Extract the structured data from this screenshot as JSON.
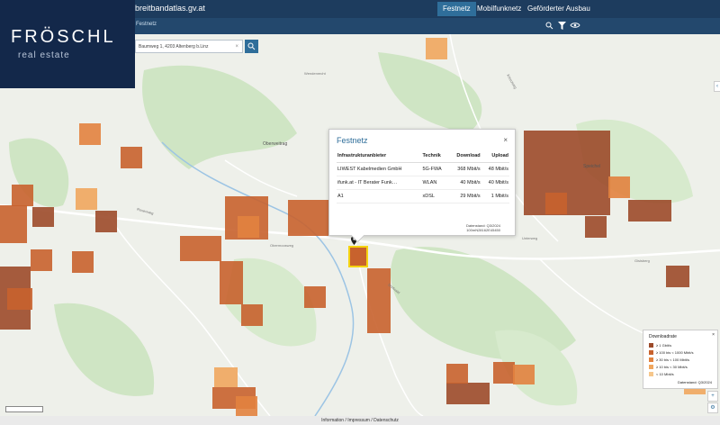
{
  "header": {
    "site_name": "breitbandatlas.gv.at",
    "nav": [
      "Festnetz",
      "Mobilfunknetz",
      "Geförderter Ausbau"
    ],
    "active_nav": "Festnetz",
    "sub_label": "Festnetz"
  },
  "search": {
    "value": "Baumweg 1, 4203 Altenberg b.Linz"
  },
  "logo": {
    "line1": "FRÖSCHL",
    "line2": "real estate"
  },
  "map_labels": {
    "place1": "Oberweitrag",
    "place2": "Speichel",
    "place3": "Wendenrecht",
    "place4": "Rosenweg",
    "place5": "Obermoosweg",
    "place6": "Dorfwald",
    "place7": "Gisisberg",
    "place8": "Kreuzweg",
    "place9": "Unterweg"
  },
  "popup": {
    "title": "Festnetz",
    "columns": [
      "Infrastrukturanbieter",
      "Technik",
      "Download",
      "Upload"
    ],
    "rows": [
      {
        "provider": "LIWEST Kabelmedien GmbH",
        "tech": "5G-FWA",
        "download": "368 Mbit/s",
        "upload": "48 Mbit/s"
      },
      {
        "provider": "ifunk.at - IT Berater Funk…",
        "tech": "WLAN",
        "download": "40 Mbit/s",
        "upload": "40 Mbit/s"
      },
      {
        "provider": "A1",
        "tech": "xDSL",
        "download": "29 Mbit/s",
        "upload": "1 Mbit/s"
      }
    ],
    "stand": "Datenstand: Q3/2024",
    "cell_id": "100mN28162E45450"
  },
  "legend": {
    "title": "Downloadrate",
    "items": [
      {
        "label": "≥ 1 Gbit/s",
        "color": "#9c4a2a"
      },
      {
        "label": "≥ 100 bis < 1000 Mbit/s",
        "color": "#c8622d"
      },
      {
        "label": "≥ 30 bis < 100 Mbit/s",
        "color": "#e2823f"
      },
      {
        "label": "≥ 10 bis < 30 Mbit/s",
        "color": "#f0a65e"
      },
      {
        "label": "< 10 Mbit/s",
        "color": "#f6c78c"
      }
    ],
    "stand": "Datenstand: Q3/2024"
  },
  "footer": {
    "text": "Information / Impressum / Datenschutz"
  },
  "colors": {
    "header": "#1d3c5e",
    "accent": "#2f6e9a",
    "logo_bg": "#13284a"
  }
}
